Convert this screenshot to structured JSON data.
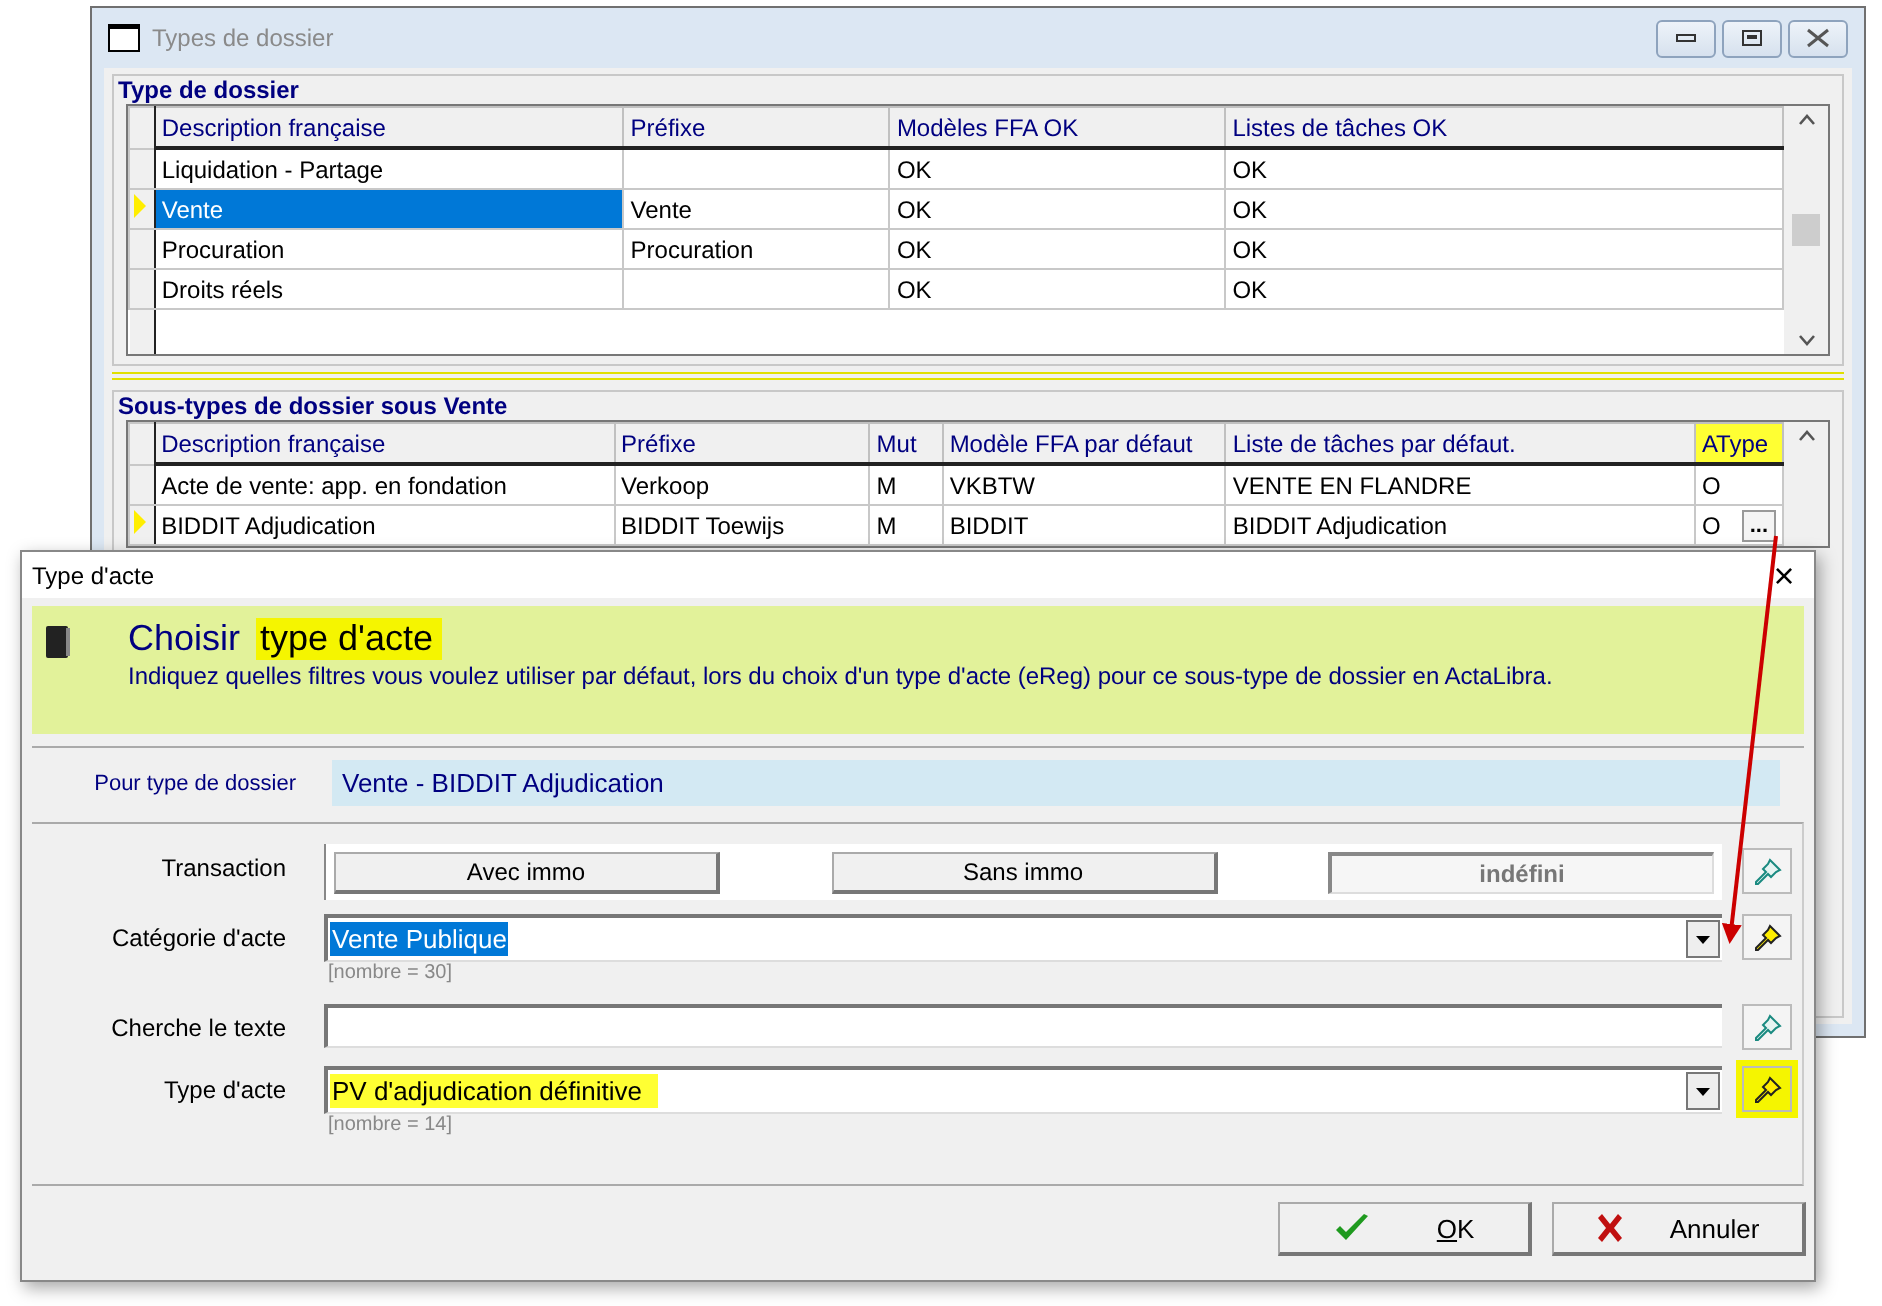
{
  "window": {
    "title": "Types de dossier"
  },
  "types_group": {
    "title": "Type de dossier",
    "columns": [
      {
        "label": "Description française",
        "highlighted": false
      },
      {
        "label": "Préfixe",
        "highlighted": false
      },
      {
        "label": "Modèles FFA OK",
        "highlighted": false
      },
      {
        "label": "Listes de tâches OK",
        "highlighted": false
      }
    ],
    "rows": [
      {
        "cells": [
          "Liquidation - Partage",
          "",
          "OK",
          "OK"
        ],
        "selected": false
      },
      {
        "cells": [
          "Vente",
          "Vente",
          "OK",
          "OK"
        ],
        "selected": true
      },
      {
        "cells": [
          "Procuration",
          "Procuration",
          "OK",
          "OK"
        ],
        "selected": false
      },
      {
        "cells": [
          "Droits réels",
          "",
          "OK",
          "OK"
        ],
        "selected": false
      }
    ]
  },
  "subtypes_group": {
    "title": "Sous-types de dossier sous Vente",
    "columns": [
      {
        "label": "Description française",
        "highlighted": false
      },
      {
        "label": "Préfixe",
        "highlighted": false
      },
      {
        "label": "Mut",
        "highlighted": false
      },
      {
        "label": "Modèle FFA par défaut",
        "highlighted": false
      },
      {
        "label": "Liste de tâches par défaut.",
        "highlighted": false
      },
      {
        "label": "AType",
        "highlighted": true
      }
    ],
    "rows": [
      {
        "cells": [
          "Acte de vente: app. en fondation",
          "Verkoop",
          "M",
          "VKBTW",
          "VENTE EN FLANDRE",
          "O"
        ],
        "selected": false
      },
      {
        "cells": [
          "BIDDIT Adjudication",
          "BIDDIT Toewijs",
          "M",
          "BIDDIT",
          "BIDDIT Adjudication",
          "O"
        ],
        "selected": true,
        "edit_button": "..."
      }
    ]
  },
  "dialog": {
    "title": "Type d'acte",
    "close": "×",
    "heading": "Choisir",
    "heading_highlight": "type d'acte",
    "description": "Indiquez quelles filtres vous voulez utiliser par défaut, lors du choix d'un type d'acte (eReg) pour ce sous-type de dossier en ActaLibra.",
    "context_label": "Pour type de dossier",
    "context_value": "Vente - BIDDIT Adjudication",
    "fields": [
      {
        "kind": "toggle",
        "label": "Transaction",
        "options": [
          {
            "label": "Avec immo",
            "selected": false
          },
          {
            "label": "Sans immo",
            "selected": false
          },
          {
            "label": "indéfini",
            "selected": true
          }
        ],
        "pin": {
          "active": false,
          "highlighted": false
        }
      },
      {
        "kind": "combo",
        "label": "Catégorie d'acte",
        "value": "Vente Publique",
        "value_selected": true,
        "value_highlighted": false,
        "count": "[nombre = 30]",
        "pin": {
          "active": true,
          "highlighted": false
        }
      },
      {
        "kind": "text",
        "label": "Cherche le texte",
        "pin": {
          "active": false,
          "highlighted": false
        }
      },
      {
        "kind": "combo",
        "label": "Type d'acte",
        "value": "PV d'adjudication définitive",
        "value_selected": false,
        "value_highlighted": true,
        "count": "[nombre = 14]",
        "pin": {
          "active": true,
          "highlighted": true
        }
      }
    ],
    "buttons": [
      {
        "kind": "ok",
        "label": "OK"
      },
      {
        "kind": "cancel",
        "label": "Annuler"
      }
    ]
  }
}
